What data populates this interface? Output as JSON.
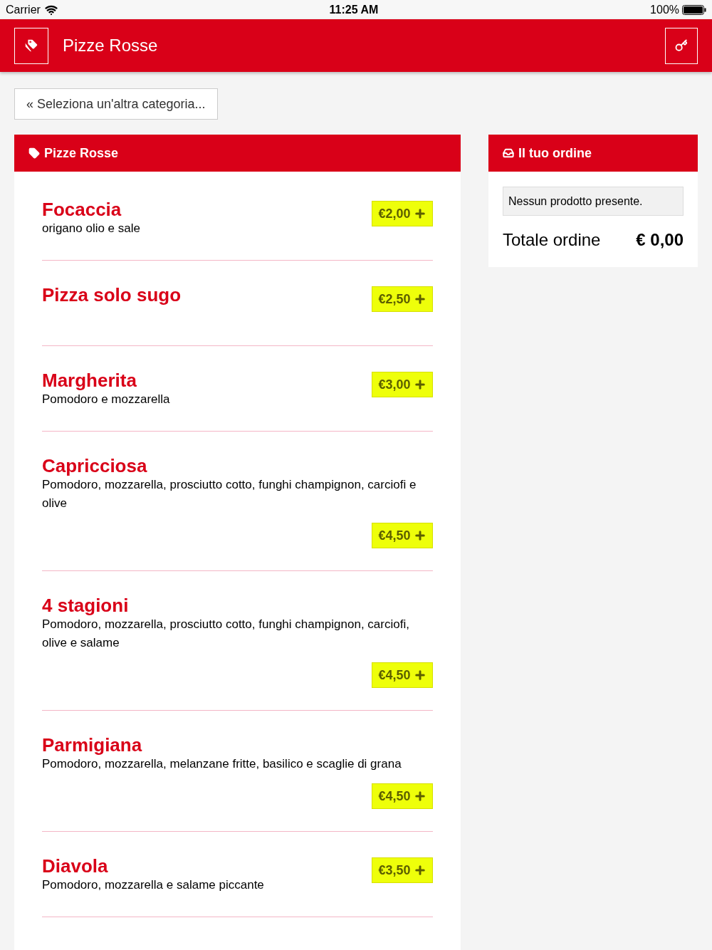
{
  "status_bar": {
    "carrier": "Carrier",
    "time": "11:25 AM",
    "battery": "100%"
  },
  "header": {
    "title": "Pizze Rosse"
  },
  "back_button": {
    "label": "« Seleziona un'altra categoria..."
  },
  "category": {
    "title": "Pizze Rosse",
    "items": [
      {
        "name": "Focaccia",
        "description": "origano olio e sale",
        "price": "€2,00",
        "kind": "inline"
      },
      {
        "name": "Pizza solo sugo",
        "price": "€2,50",
        "kind": "inline"
      },
      {
        "name": "Margherita",
        "description": "Pomodoro e mozzarella",
        "price": "€3,00",
        "kind": "inline"
      },
      {
        "name": "Capricciosa",
        "description": "Pomodoro, mozzarella, prosciutto cotto, funghi champignon, carciofi e olive",
        "price": "€4,50",
        "kind": "below"
      },
      {
        "name": "4 stagioni",
        "description": "Pomodoro, mozzarella, prosciutto cotto, funghi champignon, carciofi, olive e salame",
        "price": "€4,50",
        "kind": "below"
      },
      {
        "name": "Parmigiana",
        "description": "Pomodoro, mozzarella, melanzane fritte, basilico e scaglie di grana",
        "price": "€4,50",
        "kind": "below"
      },
      {
        "name": "Diavola",
        "description": "Pomodoro, mozzarella e salame piccante",
        "price": "€3,50",
        "kind": "inline"
      }
    ]
  },
  "order": {
    "title": "Il tuo ordine",
    "empty_message": "Nessun prodotto presente.",
    "total_label": "Totale ordine",
    "total": "€ 0,00"
  }
}
